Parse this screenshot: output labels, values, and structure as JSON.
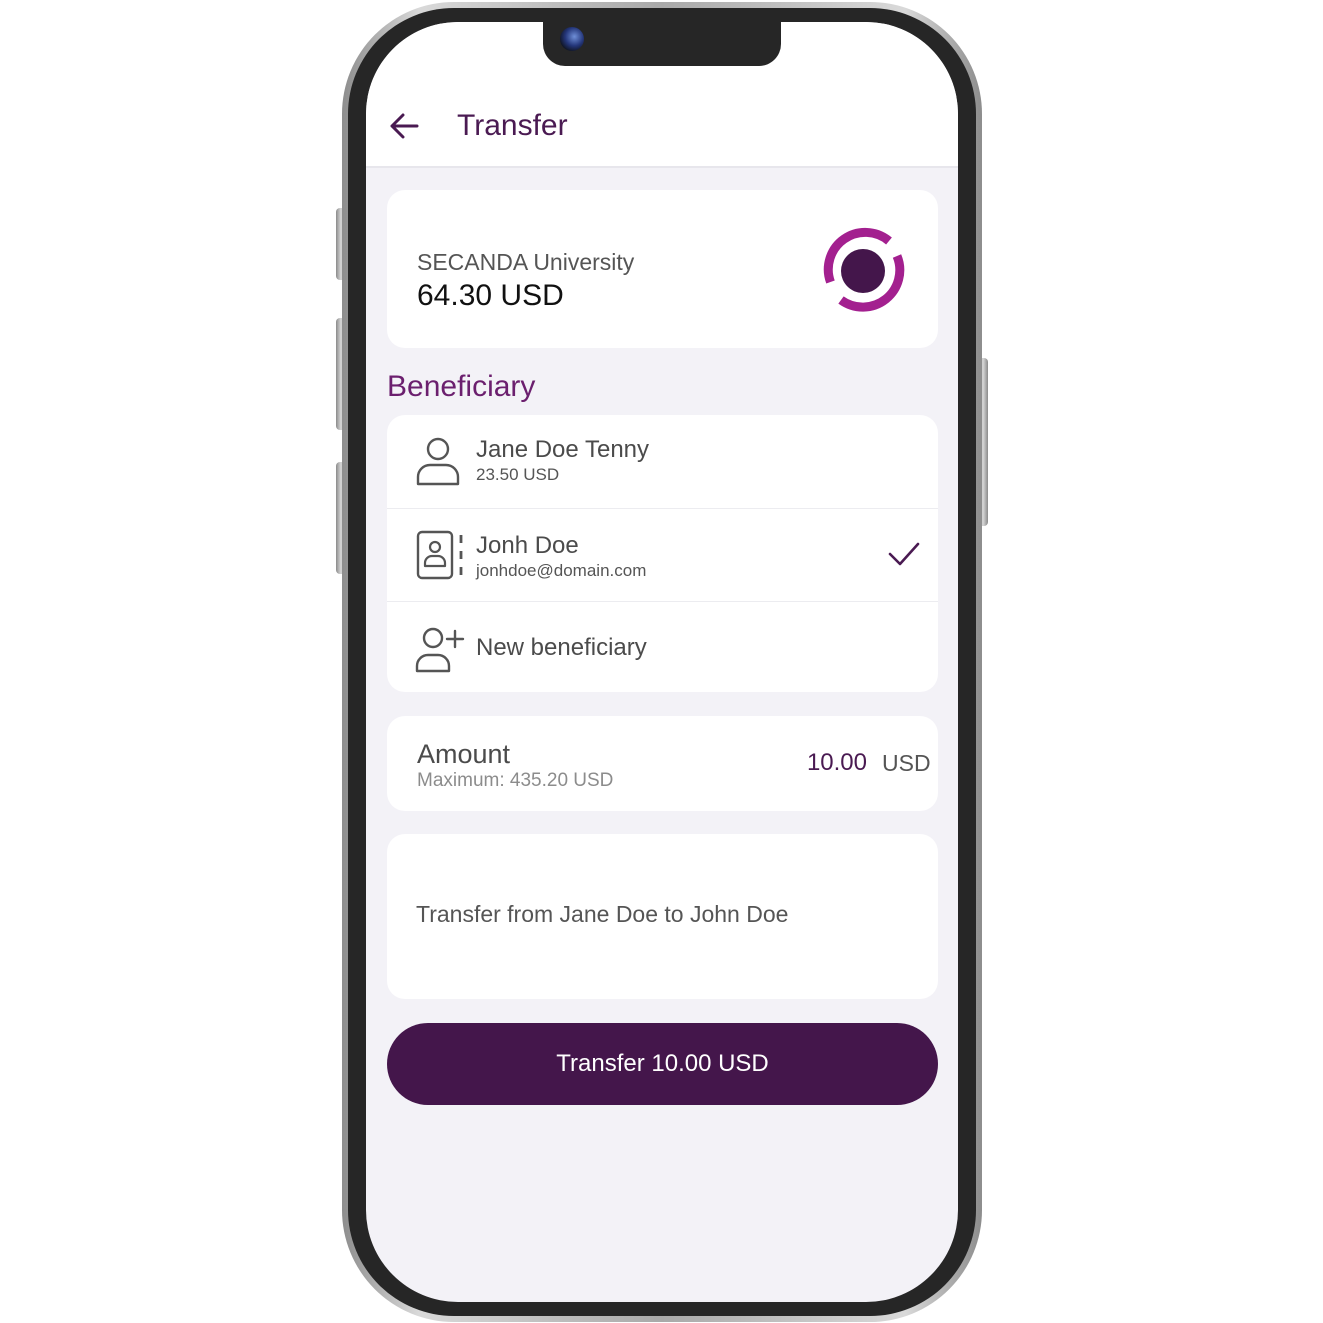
{
  "header": {
    "title": "Transfer",
    "back_icon": "arrow-left-icon"
  },
  "account": {
    "name": "SECANDA University",
    "balance": "64.30 USD",
    "logo_icon": "secanda-logo-icon"
  },
  "beneficiary": {
    "section_title": "Beneficiary",
    "items": [
      {
        "name": "Jane Doe Tenny",
        "detail": "23.50 USD",
        "icon": "person-icon",
        "selected": false
      },
      {
        "name": "Jonh Doe",
        "detail": "jonhdoe@domain.com",
        "icon": "contact-card-icon",
        "selected": true
      },
      {
        "name": "New beneficiary",
        "icon": "add-person-icon"
      }
    ],
    "selected_icon": "checkmark-icon"
  },
  "amount": {
    "label": "Amount",
    "maximum": "Maximum: 435.20 USD",
    "value": "10.00",
    "currency": "USD"
  },
  "note": {
    "text": "Transfer from Jane Doe to John Doe"
  },
  "submit": {
    "label": "Transfer 10.00 USD"
  },
  "colors": {
    "primary": "#44164b",
    "accent": "#6b1f6e",
    "logo_ring": "#a3208f",
    "screen_background": "#f3f2f7"
  }
}
